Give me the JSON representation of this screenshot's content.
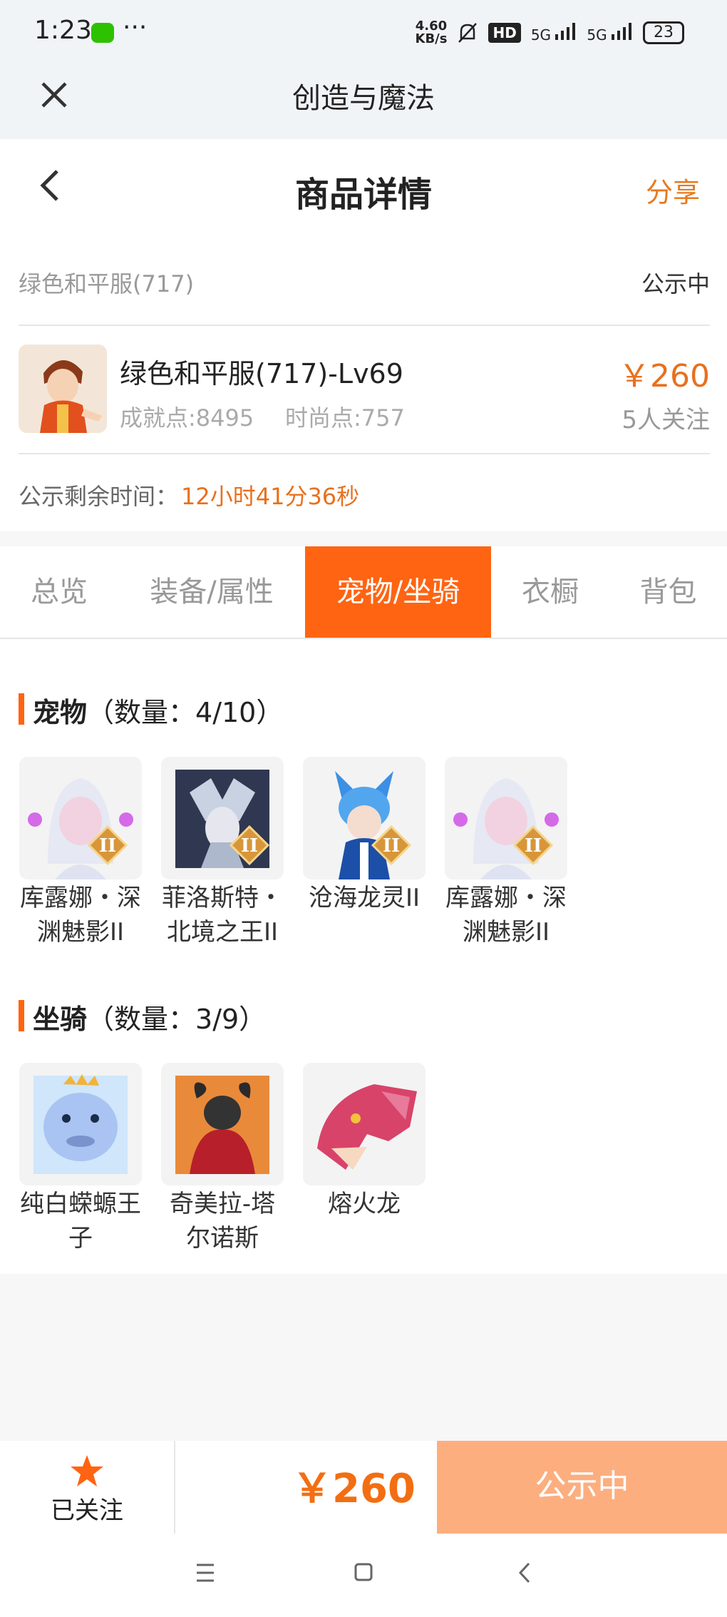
{
  "status_bar": {
    "time": "1:23",
    "dots": "···",
    "net_speed_value": "4.60",
    "net_speed_unit": "KB/s",
    "hd_label": "HD",
    "sim1": "5G",
    "sim2": "5G",
    "battery": "23"
  },
  "app_bar": {
    "title": "创造与魔法"
  },
  "header": {
    "title": "商品详情",
    "share_label": "分享"
  },
  "product": {
    "subtitle": "绿色和平服(717)",
    "status": "公示中",
    "name": "绿色和平服(717)-Lv69",
    "achievement": "成就点:8495",
    "fashion": "时尚点:757",
    "price": "￥260",
    "followers": "5人关注",
    "remaining_label": "公示剩余时间：",
    "remaining_value": "12小时41分36秒"
  },
  "tabs": [
    {
      "label": "总览",
      "active": false
    },
    {
      "label": "装备/属性",
      "active": false
    },
    {
      "label": "宠物/坐骑",
      "active": true
    },
    {
      "label": "衣橱",
      "active": false
    },
    {
      "label": "背包",
      "active": false
    }
  ],
  "pets": {
    "title": "宠物",
    "count": "（数量：4/10）",
    "items": [
      {
        "name": "库露娜・深渊魅影II",
        "badge": "II"
      },
      {
        "name": "菲洛斯特・北境之王II",
        "badge": "II"
      },
      {
        "name": "沧海龙灵II",
        "badge": "II"
      },
      {
        "name": "库露娜・深渊魅影II",
        "badge": "II"
      }
    ]
  },
  "mounts": {
    "title": "坐骑",
    "count": "（数量：3/9）",
    "items": [
      {
        "name": "纯白蝾螈王子"
      },
      {
        "name": "奇美拉-塔尔诺斯"
      },
      {
        "name": "熔火龙"
      }
    ]
  },
  "footer": {
    "follow_label": "已关注",
    "price": "￥260",
    "action_label": "公示中"
  },
  "colors": {
    "accent": "#ff6412",
    "price": "#e8701e",
    "action_disabled": "#fdae7f",
    "star": "#ff6412"
  },
  "icons": {
    "close": "close-icon",
    "back": "back-icon",
    "star": "star-icon",
    "nav_menu": "menu-icon",
    "nav_home": "home-icon",
    "nav_back": "nav-back-icon"
  }
}
